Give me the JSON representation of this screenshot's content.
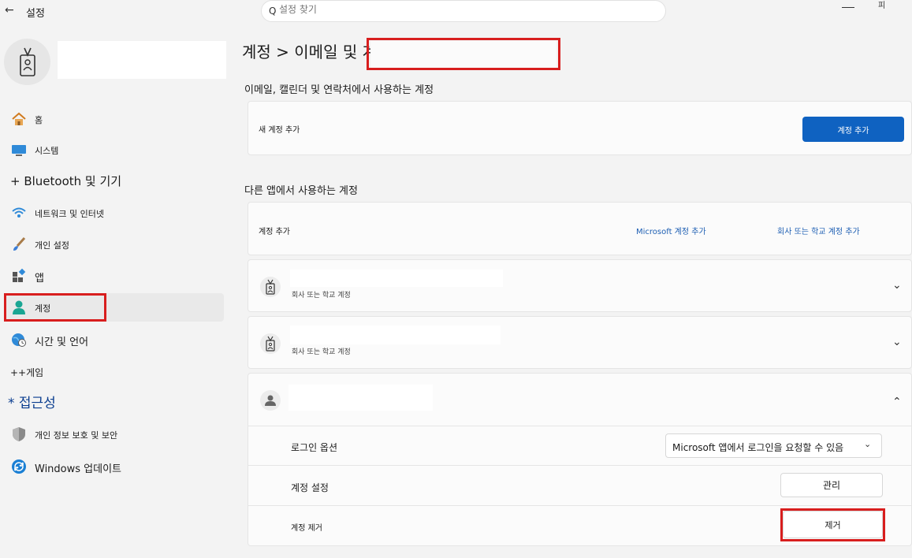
{
  "window": {
    "title": "설정",
    "back_icon": "arrow-left-icon",
    "minimize_icon": "minimize-icon",
    "maximize_label": "피"
  },
  "search": {
    "placeholder": "설정 찾기",
    "icon": "Q"
  },
  "sidebar": {
    "items": [
      {
        "label": "홈",
        "icon": "home-icon"
      },
      {
        "label": "시스템",
        "icon": "monitor-icon"
      },
      {
        "label": "+ Bluetooth 및 기기",
        "icon": ""
      },
      {
        "label": "네트워크 및 인터넷",
        "icon": "wifi-icon"
      },
      {
        "label": "개인 설정",
        "icon": "brush-icon"
      },
      {
        "label": "앱",
        "icon": "apps-icon"
      },
      {
        "label": "계정",
        "icon": "person-icon"
      },
      {
        "label": "시간 및 언어",
        "icon": "globe-clock-icon"
      },
      {
        "label": "++게임",
        "icon": ""
      },
      {
        "label": "* 접근성",
        "icon": ""
      },
      {
        "label": "개인 정보 보호 및 보안",
        "icon": "shield-icon"
      },
      {
        "label": "Windows 업데이트",
        "icon": "update-icon"
      }
    ]
  },
  "main": {
    "breadcrumb": "계정 > 이메일 및 계정",
    "section_email": "이메일, 캘린더 및 연락처에서 사용하는 계정",
    "new_account_label": "새 계정 추가",
    "add_account_button": "계정 추가",
    "section_other": "다른 앱에서 사용하는 계정",
    "add_account_label": "계정 추가",
    "add_ms_account": "Microsoft 계정 추가",
    "add_work_account": "회사 또는 학교 계정 추가",
    "accounts": [
      {
        "type": "회사 또는 학교 계정",
        "icon": "badge-icon"
      },
      {
        "type": "회사 또는 학교 계정",
        "icon": "badge-icon"
      },
      {
        "type": "",
        "icon": "person-icon"
      }
    ],
    "signin_options_label": "로그인 옵션",
    "signin_options_value": "Microsoft 앱에서 로그인을 요청할 수 있음",
    "account_settings_label": "계정 설정",
    "manage_button": "관리",
    "remove_account_label": "계정 제거",
    "remove_button": "제거"
  },
  "colors": {
    "accent": "#0f62c1",
    "highlight": "#d81e1e"
  }
}
